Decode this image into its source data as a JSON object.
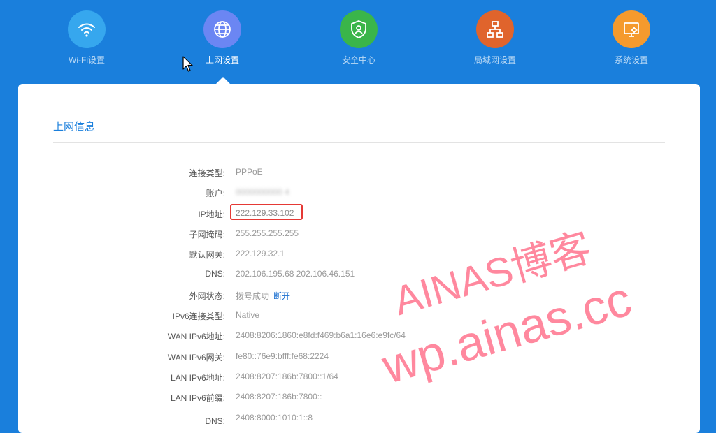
{
  "nav": {
    "items": [
      {
        "label": "Wi-Fi设置",
        "icon": "wifi-icon",
        "color": "#36a7ee"
      },
      {
        "label": "上网设置",
        "icon": "globe-icon",
        "color": "#6b86f3"
      },
      {
        "label": "安全中心",
        "icon": "shield-user-icon",
        "color": "#3ab54a"
      },
      {
        "label": "局域网设置",
        "icon": "network-icon",
        "color": "#e0642c"
      },
      {
        "label": "系统设置",
        "icon": "settings-screen-icon",
        "color": "#f59a2d"
      }
    ],
    "active_index": 1
  },
  "section": {
    "title": "上网信息"
  },
  "info": [
    {
      "label": "连接类型:",
      "value": "PPPoE"
    },
    {
      "label": "账户:",
      "value": "0000000000 4"
    },
    {
      "label": "IP地址:",
      "value": "222.129.33.102"
    },
    {
      "label": "子网掩码:",
      "value": "255.255.255.255"
    },
    {
      "label": "默认网关:",
      "value": "222.129.32.1"
    },
    {
      "label": "DNS:",
      "value": "202.106.195.68 202.106.46.151"
    },
    {
      "label": "外网状态:",
      "value": "拨号成功",
      "link": "断开"
    },
    {
      "label": "IPv6连接类型:",
      "value": "Native"
    },
    {
      "label": "WAN IPv6地址:",
      "value": "2408:8206:1860:e8fd:f469:b6a1:16e6:e9fc/64"
    },
    {
      "label": "WAN IPv6网关:",
      "value": "fe80::76e9:bfff:fe68:2224"
    },
    {
      "label": "LAN IPv6地址:",
      "value": "2408:8207:186b:7800::1/64"
    },
    {
      "label": "LAN IPv6前缀:",
      "value": "2408:8207:186b:7800::"
    },
    {
      "label": "DNS:",
      "value": "2408:8000:1010:1::8"
    }
  ],
  "watermark": {
    "line1": "AINAS博客",
    "line2": "wp.ainas.cc"
  }
}
